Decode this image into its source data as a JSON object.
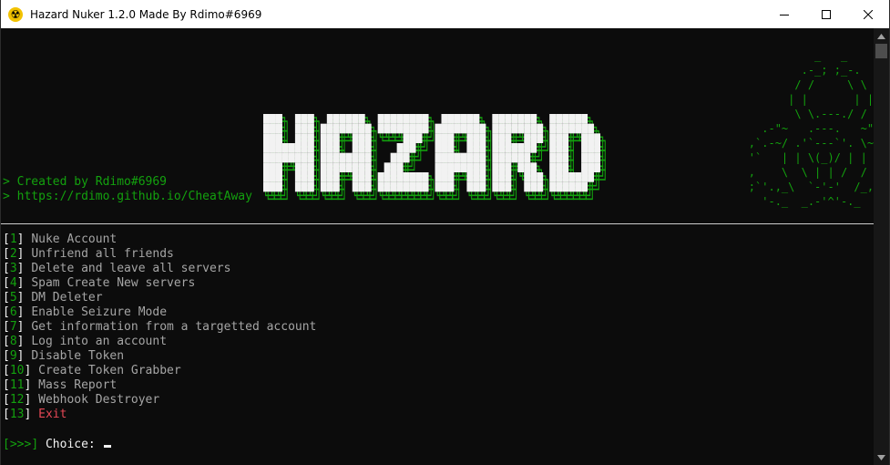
{
  "window": {
    "title": "Hazard Nuker 1.2.0 Made By Rdimo#6969",
    "icon": "radioactive-icon"
  },
  "header": {
    "credit_line": "> Created by Rdimo#6969",
    "url_line": "> https://rdimo.github.io/CheatAway",
    "logo_text": "HAZARD",
    "skull_art": "                  _   _\n                .-_; ;_-.\n               / /     \\ \\\n              | |       | |\n               \\ \\.---./ /\n          .-\"~   .---.   ~\"-.\n        ,`.-~/ .'`---`'. \\~-.`,\n        '`   | | \\(_)/ | |   `'\n        ,    \\  \\ | | /  /    ,\n        ;`'.,_\\  `-'-'  /_,.'`;\n          '-._  _.-'^'-._  _.-'"
  },
  "menu": {
    "items": [
      {
        "num": "1",
        "label": "Nuke Account"
      },
      {
        "num": "2",
        "label": "Unfriend all friends"
      },
      {
        "num": "3",
        "label": "Delete and leave all servers"
      },
      {
        "num": "4",
        "label": "Spam Create New servers"
      },
      {
        "num": "5",
        "label": "DM Deleter"
      },
      {
        "num": "6",
        "label": "Enable Seizure Mode"
      },
      {
        "num": "7",
        "label": "Get information from a targetted account"
      },
      {
        "num": "8",
        "label": "Log into an account"
      },
      {
        "num": "9",
        "label": "Disable Token"
      },
      {
        "num": "10",
        "label": "Create Token Grabber"
      },
      {
        "num": "11",
        "label": "Mass Report"
      },
      {
        "num": "12",
        "label": "Webhook Destroyer"
      },
      {
        "num": "13",
        "label": "Exit"
      }
    ]
  },
  "prompt": {
    "marker": ">>>",
    "label": "Choice:"
  },
  "colors": {
    "background": "#0c0c0c",
    "accent_green": "#13a10e",
    "menu_text": "#a5a5a5",
    "exit_red": "#e74856",
    "logo_white": "#f2f2f2"
  }
}
